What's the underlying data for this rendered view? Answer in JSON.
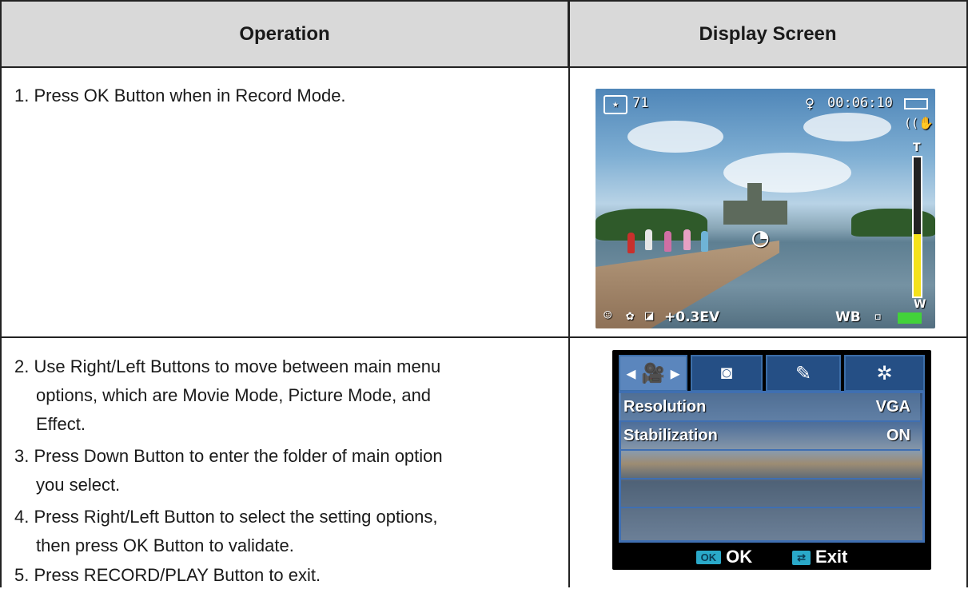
{
  "table": {
    "header": {
      "operation": "Operation",
      "display": "Display Screen"
    },
    "rows": [
      {
        "steps": [
          "1. Press OK Button when in Record Mode."
        ]
      },
      {
        "steps": [
          "2. Use Right/Left Buttons to move between main menu",
          "options, which are Movie Mode, Picture Mode, and",
          "Effect.",
          "3. Press Down Button to enter the folder of main option",
          "you select.",
          "4. Press Right/Left Button to select the setting options,",
          "then press OK Button to validate.",
          "5. Press RECORD/PLAY Button to exit."
        ]
      }
    ]
  },
  "screen1": {
    "shots_remaining": "71",
    "timecode": "00:06:10",
    "zoom_top": "T",
    "zoom_bottom": "W",
    "zoom_level": 0.45,
    "ev": "+0.3EV",
    "wb": "WB",
    "icons": [
      "camera-icon",
      "bulb-icon",
      "stabilizer-icon",
      "self-timer-icon",
      "face-icon",
      "macro-icon",
      "ev-icon",
      "battery-icon"
    ]
  },
  "screen2": {
    "tabs": [
      "movie-icon",
      "camera-icon",
      "effect-icon",
      "settings-icon"
    ],
    "active_tab": 0,
    "rows": [
      {
        "label": "Resolution",
        "value": "VGA"
      },
      {
        "label": "Stabilization",
        "value": "ON"
      }
    ],
    "ok_key": "OK",
    "ok_label": "OK",
    "exit_label": "Exit",
    "accent": "#3f6fb2"
  }
}
